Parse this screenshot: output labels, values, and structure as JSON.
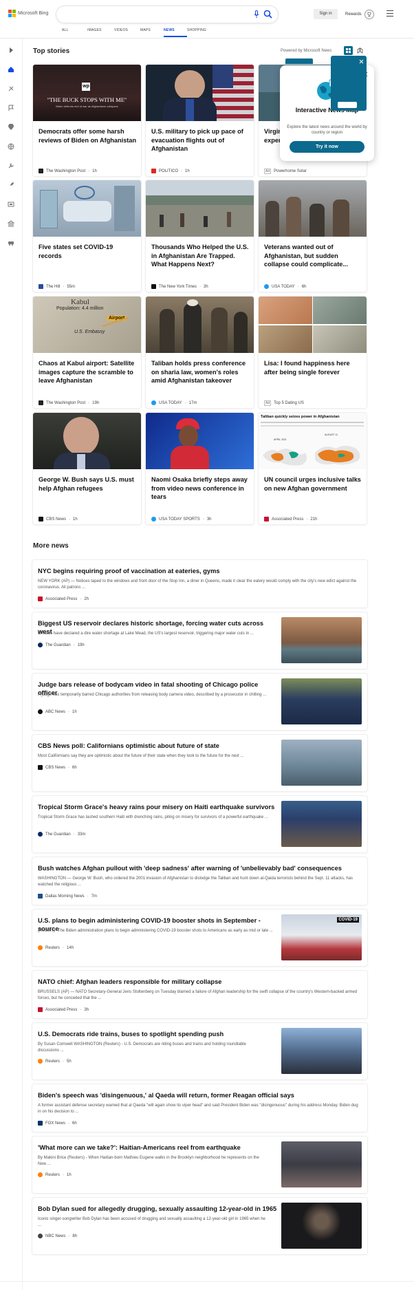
{
  "header": {
    "logo_text": "Microsoft Bing",
    "search_value": "",
    "signin_label": "Sign in",
    "rewards_label": "Rewards",
    "tabs": [
      "ALL",
      "IMAGES",
      "VIDEOS",
      "MAPS",
      "NEWS",
      "SHOPPING"
    ]
  },
  "top_stories": {
    "heading": "Top stories",
    "powered": "Powered by Microsoft News"
  },
  "popup": {
    "title": "Interactive News Map",
    "desc": "Explore the latest news around the world by country or region",
    "button": "Try it now"
  },
  "cards": [
    {
      "title": "Democrats offer some harsh reviews of Biden on Afghanistan",
      "source": "The Washington Post",
      "time": "1h",
      "img_text": "\"THE BUCK STOPS WITH ME\"",
      "img_sub": "Biden defends end of war as Afghanistan collapses",
      "img_badge": "wp",
      "logo": "#222222"
    },
    {
      "title": "U.S. military to pick up pace of evacuation flights out of Afghanistan",
      "source": "POLITICO",
      "time": "1h",
      "logo": "#d62b27"
    },
    {
      "title": "Virginia homeowners who live in expensive areas should live in...",
      "source": "Powerhome Solar",
      "ad": "Ad",
      "logo": "#999999"
    },
    {
      "title": "Five states set COVID-19 records",
      "source": "The Hill",
      "time": "55m",
      "logo": "#2a4b9b"
    },
    {
      "title": "Thousands Who Helped the U.S. in Afghanistan Are Trapped. What Happens Next?",
      "source": "The New York Times",
      "time": "3h",
      "logo": "#111111"
    },
    {
      "title": "Veterans wanted out of Afghanistan, but sudden collapse could complicate...",
      "source": "USA TODAY",
      "time": "6h",
      "logo": "#1d9bf0"
    },
    {
      "title": "Chaos at Kabul airport: Satellite images capture the scramble to leave Afghanistan",
      "source": "The Washington Post",
      "time": "19h",
      "img_map": [
        "Kabul",
        "Population: 4.4 million",
        "Airport",
        "U.S. Embassy"
      ],
      "logo": "#222222"
    },
    {
      "title": "Taliban holds press conference on sharia law, women's roles amid Afghanistan takeover",
      "source": "USA TODAY",
      "time": "17m",
      "logo": "#1d9bf0"
    },
    {
      "title": "Lisa: I found happiness here after being single forever",
      "source": "Top 5 Dating US",
      "ad": "Ad",
      "logo": "#999999"
    },
    {
      "title": "George W. Bush says U.S. must help Afghan refugees",
      "source": "CBS News",
      "time": "1h",
      "logo": "#111111"
    },
    {
      "title": "Naomi Osaka briefly steps away from video news conference in tears",
      "source": "USA TODAY SPORTS",
      "time": "3h",
      "logo": "#1d9bf0"
    },
    {
      "title": "UN council urges inclusive talks on new Afghan government",
      "source": "Associated Press",
      "time": "21h",
      "img_chart_title": "Taliban quickly seizes power in Afghanistan",
      "img_chart_left": "APRIL 2021",
      "img_chart_right": "AUGUST 11",
      "logo": "#c8102e"
    }
  ],
  "more_news": {
    "heading": "More news",
    "items": [
      {
        "title": "NYC begins requiring proof of vaccination at eateries, gyms",
        "desc": "NEW YORK (AP) — Notices taped to the windows and front door of the Stop Inn, a diner in Queens, made it clear the eatery would comply with the city's new edict against the coronavirus. All patrons ...",
        "source": "Associated Press",
        "time": "2h",
        "logo": "#c8102e",
        "img": false
      },
      {
        "title": "Biggest US reservoir declares historic shortage, forcing water cuts across west",
        "desc": "Officials have declared a dire water shortage at Lake Mead, the US's largest reservoir, triggering major water cuts in ...",
        "source": "The Guardian",
        "time": "19h",
        "logo": "#052962",
        "img": true
      },
      {
        "title": "Judge bars release of bodycam video in fatal shooting of Chicago police officer",
        "desc": "A judge has temporarily barred Chicago authorities from releasing body camera video, described by a prosecutor in chilling ...",
        "source": "ABC News",
        "time": "1h",
        "logo": "#111111",
        "img": true
      },
      {
        "title": "CBS News poll: Californians optimistic about future of state",
        "desc": "Most Californians say they are optimistic about the future of their state when they look to the future for the next ...",
        "source": "CBS News",
        "time": "6h",
        "logo": "#111111",
        "img": true
      },
      {
        "title": "Tropical Storm Grace's heavy rains pour misery on Haiti earthquake survivors",
        "desc": "Tropical Storm Grace has lashed southern Haiti with drenching rains, piling on misery for survivors of a powerful earthquake ...",
        "source": "The Guardian",
        "time": "33m",
        "logo": "#052962",
        "img": true
      },
      {
        "title": "Bush watches Afghan pullout with 'deep sadness' after warning of 'unbelievably bad' consequences",
        "desc": "WASHINGTON — George W. Bush, who ordered the 2001 invasion of Afghanistan to dislodge the Taliban and hunt down al-Qaida terrorists behind the Sept. 11 attacks, has watched the religious ...",
        "source": "Dallas Morning News",
        "time": "7m",
        "logo": "#1f4e8c",
        "img": false
      },
      {
        "title": "U.S. plans to begin administering COVID-19 booster shots in September - source",
        "desc": "(Reuters) -The Biden administration plans to begin administering COVID-19 booster shots to Americans as early as mid or late ...",
        "source": "Reuters",
        "time": "14h",
        "logo": "#ff8000",
        "img": true,
        "img_badge": "COVID-19"
      },
      {
        "title": "NATO chief: Afghan leaders responsible for military collapse",
        "desc": "BRUSSELS (AP) — NATO Secretary-General Jens Stoltenberg on Tuesday blamed a failure of Afghan leadership for the swift collapse of the country's Western-backed armed forces, but he conceded that the ...",
        "source": "Associated Press",
        "time": "3h",
        "logo": "#c8102e",
        "img": false
      },
      {
        "title": "U.S. Democrats ride trains, buses to spotlight spending push",
        "desc": "By Susan Cornwell WASHINGTON (Reuters) - U.S. Democrats are riding buses and trains and holding roundtable discussions ...",
        "source": "Reuters",
        "time": "5h",
        "logo": "#ff8000",
        "img": true
      },
      {
        "title": "Biden's speech was 'disingenuous,' al Qaeda will return, former Reagan official says",
        "desc": "A former assistant defense secretary warned that al Qaeda \"will again show its viper head\" and said President Biden was \"disingenuous\" during his address Monday. Biden dug in on his decision to ...",
        "source": "FOX News",
        "time": "6h",
        "logo": "#003366",
        "img": false
      },
      {
        "title": "'What more can we take?': Haitian-Americans reel from earthquake",
        "desc": "By Makini Brice (Reuters) - When Haitian-born Mathieu Eugene walks in the Brooklyn neighborhood he represents on the New ...",
        "source": "Reuters",
        "time": "1h",
        "logo": "#ff8000",
        "img": true
      },
      {
        "title": "Bob Dylan sued for allegedly drugging, sexually assaulting 12-year-old in 1965",
        "desc": "Iconic singer-songwriter Bob Dylan has been accused of drugging and sexually assaulting a 12-year-old girl in 1965 when he ...",
        "source": "NBC News",
        "time": "8h",
        "logo": "#444444",
        "img": true
      }
    ]
  }
}
